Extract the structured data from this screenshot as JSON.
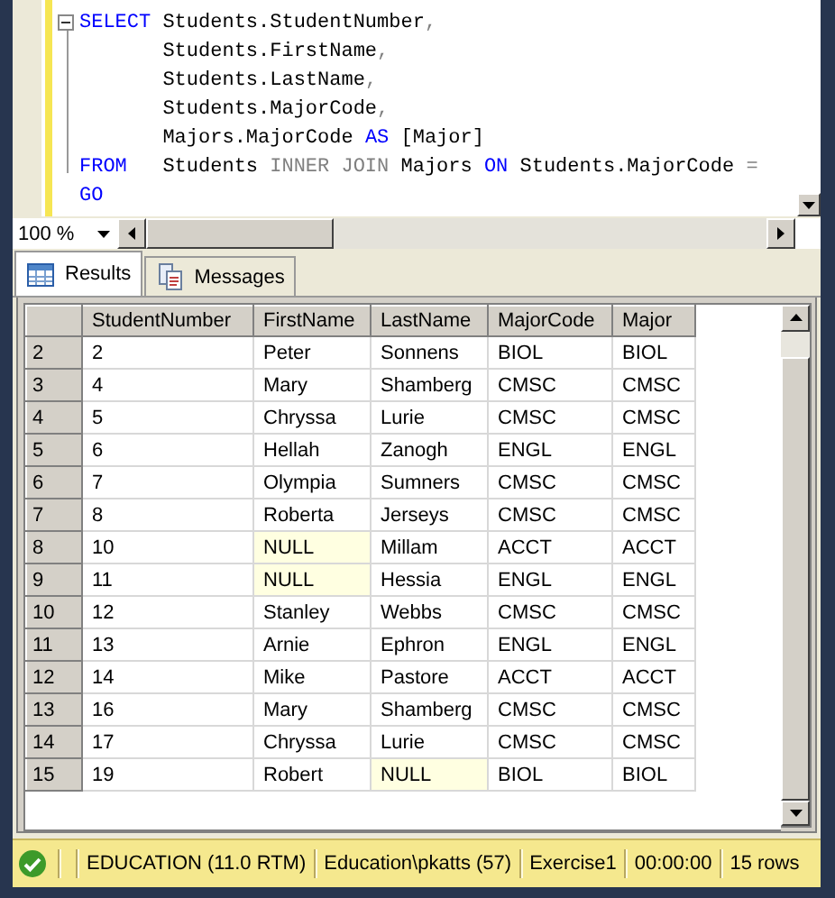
{
  "editor": {
    "lines": [
      [
        {
          "kind": "keyword",
          "text": "SELECT"
        },
        {
          "kind": "text",
          "text": " Students.StudentNumber"
        },
        {
          "kind": "operator",
          "text": ","
        }
      ],
      [
        {
          "kind": "text",
          "text": "       Students.FirstName"
        },
        {
          "kind": "operator",
          "text": ","
        }
      ],
      [
        {
          "kind": "text",
          "text": "       Students.LastName"
        },
        {
          "kind": "operator",
          "text": ","
        }
      ],
      [
        {
          "kind": "text",
          "text": "       Students.MajorCode"
        },
        {
          "kind": "operator",
          "text": ","
        }
      ],
      [
        {
          "kind": "text",
          "text": "       Majors.MajorCode "
        },
        {
          "kind": "keyword",
          "text": "AS"
        },
        {
          "kind": "text",
          "text": " [Major]"
        }
      ],
      [
        {
          "kind": "keyword",
          "text": "FROM"
        },
        {
          "kind": "text",
          "text": "   Students "
        },
        {
          "kind": "operator",
          "text": "INNER JOIN"
        },
        {
          "kind": "text",
          "text": " Majors "
        },
        {
          "kind": "keyword",
          "text": "ON"
        },
        {
          "kind": "text",
          "text": " Students.MajorCode "
        },
        {
          "kind": "operator",
          "text": "="
        }
      ],
      [
        {
          "kind": "keyword",
          "text": "GO"
        }
      ]
    ]
  },
  "zoom": "100 %",
  "tabs": [
    {
      "label": "Results",
      "selected": true
    },
    {
      "label": "Messages",
      "selected": false
    }
  ],
  "grid": {
    "columns": [
      "StudentNumber",
      "FirstName",
      "LastName",
      "MajorCode",
      "Major"
    ],
    "rows": [
      {
        "number": "2",
        "cells": [
          {
            "text": "2",
            "is_null": false
          },
          {
            "text": "Peter",
            "is_null": false
          },
          {
            "text": "Sonnens",
            "is_null": false
          },
          {
            "text": "BIOL",
            "is_null": false
          },
          {
            "text": "BIOL",
            "is_null": false
          }
        ]
      },
      {
        "number": "3",
        "cells": [
          {
            "text": "4",
            "is_null": false
          },
          {
            "text": "Mary",
            "is_null": false
          },
          {
            "text": "Shamberg",
            "is_null": false
          },
          {
            "text": "CMSC",
            "is_null": false
          },
          {
            "text": "CMSC",
            "is_null": false
          }
        ]
      },
      {
        "number": "4",
        "cells": [
          {
            "text": "5",
            "is_null": false
          },
          {
            "text": "Chryssa",
            "is_null": false
          },
          {
            "text": "Lurie",
            "is_null": false
          },
          {
            "text": "CMSC",
            "is_null": false
          },
          {
            "text": "CMSC",
            "is_null": false
          }
        ]
      },
      {
        "number": "5",
        "cells": [
          {
            "text": "6",
            "is_null": false
          },
          {
            "text": "Hellah",
            "is_null": false
          },
          {
            "text": "Zanogh",
            "is_null": false
          },
          {
            "text": "ENGL",
            "is_null": false
          },
          {
            "text": "ENGL",
            "is_null": false
          }
        ]
      },
      {
        "number": "6",
        "cells": [
          {
            "text": "7",
            "is_null": false
          },
          {
            "text": "Olympia",
            "is_null": false
          },
          {
            "text": "Sumners",
            "is_null": false
          },
          {
            "text": "CMSC",
            "is_null": false
          },
          {
            "text": "CMSC",
            "is_null": false
          }
        ]
      },
      {
        "number": "7",
        "cells": [
          {
            "text": "8",
            "is_null": false
          },
          {
            "text": "Roberta",
            "is_null": false
          },
          {
            "text": "Jerseys",
            "is_null": false
          },
          {
            "text": "CMSC",
            "is_null": false
          },
          {
            "text": "CMSC",
            "is_null": false
          }
        ]
      },
      {
        "number": "8",
        "cells": [
          {
            "text": "10",
            "is_null": false
          },
          {
            "text": "NULL",
            "is_null": true
          },
          {
            "text": "Millam",
            "is_null": false
          },
          {
            "text": "ACCT",
            "is_null": false
          },
          {
            "text": "ACCT",
            "is_null": false
          }
        ]
      },
      {
        "number": "9",
        "cells": [
          {
            "text": "11",
            "is_null": false
          },
          {
            "text": "NULL",
            "is_null": true
          },
          {
            "text": "Hessia",
            "is_null": false
          },
          {
            "text": "ENGL",
            "is_null": false
          },
          {
            "text": "ENGL",
            "is_null": false
          }
        ]
      },
      {
        "number": "10",
        "cells": [
          {
            "text": "12",
            "is_null": false
          },
          {
            "text": "Stanley",
            "is_null": false
          },
          {
            "text": "Webbs",
            "is_null": false
          },
          {
            "text": "CMSC",
            "is_null": false
          },
          {
            "text": "CMSC",
            "is_null": false
          }
        ]
      },
      {
        "number": "11",
        "cells": [
          {
            "text": "13",
            "is_null": false
          },
          {
            "text": "Arnie",
            "is_null": false
          },
          {
            "text": "Ephron",
            "is_null": false
          },
          {
            "text": "ENGL",
            "is_null": false
          },
          {
            "text": "ENGL",
            "is_null": false
          }
        ]
      },
      {
        "number": "12",
        "cells": [
          {
            "text": "14",
            "is_null": false
          },
          {
            "text": "Mike",
            "is_null": false
          },
          {
            "text": "Pastore",
            "is_null": false
          },
          {
            "text": "ACCT",
            "is_null": false
          },
          {
            "text": "ACCT",
            "is_null": false
          }
        ]
      },
      {
        "number": "13",
        "cells": [
          {
            "text": "16",
            "is_null": false
          },
          {
            "text": "Mary",
            "is_null": false
          },
          {
            "text": "Shamberg",
            "is_null": false
          },
          {
            "text": "CMSC",
            "is_null": false
          },
          {
            "text": "CMSC",
            "is_null": false
          }
        ]
      },
      {
        "number": "14",
        "cells": [
          {
            "text": "17",
            "is_null": false
          },
          {
            "text": "Chryssa",
            "is_null": false
          },
          {
            "text": "Lurie",
            "is_null": false
          },
          {
            "text": "CMSC",
            "is_null": false
          },
          {
            "text": "CMSC",
            "is_null": false
          }
        ]
      },
      {
        "number": "15",
        "cells": [
          {
            "text": "19",
            "is_null": false
          },
          {
            "text": "Robert",
            "is_null": false
          },
          {
            "text": "NULL",
            "is_null": true
          },
          {
            "text": "BIOL",
            "is_null": false
          },
          {
            "text": "BIOL",
            "is_null": false
          }
        ]
      }
    ]
  },
  "status_bar": {
    "items": [
      "EDUCATION (11.0 RTM)",
      "Education\\pkatts (57)",
      "Exercise1",
      "00:00:00",
      "15 rows"
    ]
  }
}
